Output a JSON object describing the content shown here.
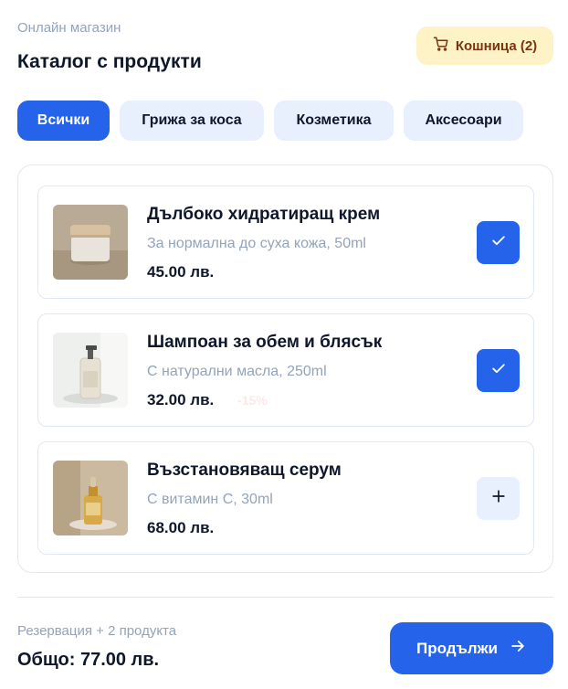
{
  "header": {
    "store_label": "Онлайн магазин",
    "title": "Каталог с продукти",
    "cart_label": "Кошница (2)",
    "cart_icon": "cart-icon"
  },
  "tabs": [
    {
      "label": "Всички",
      "active": true
    },
    {
      "label": "Грижа за коса",
      "active": false
    },
    {
      "label": "Козметика",
      "active": false
    },
    {
      "label": "Аксесоари",
      "active": false
    }
  ],
  "products": [
    {
      "name": "Дълбоко хидратиращ крем",
      "description": "За нормална до суха кожа, 50ml",
      "price": "45.00 лв.",
      "discount": "",
      "state": "checked",
      "icon": "check-icon"
    },
    {
      "name": "Шампоан за обем и блясък",
      "description": "С натурални масла, 250ml",
      "price": "32.00 лв.",
      "discount": "-15%",
      "state": "checked",
      "icon": "check-icon"
    },
    {
      "name": "Възстановяващ серум",
      "description": "С витамин C, 30ml",
      "price": "68.00 лв.",
      "discount": "",
      "state": "add",
      "icon": "plus-icon"
    }
  ],
  "footer": {
    "summary": "Резервация + 2 продукта",
    "total": "Общо: 77.00 лв.",
    "continue_label": "Продължи",
    "continue_icon": "arrow-right-icon"
  },
  "colors": {
    "accent": "#2563eb",
    "accent_soft": "#e8effd",
    "cart_bg": "#fef3c7",
    "cart_text": "#78350f",
    "muted_text": "#94a3b8",
    "heading": "#0f172a"
  }
}
